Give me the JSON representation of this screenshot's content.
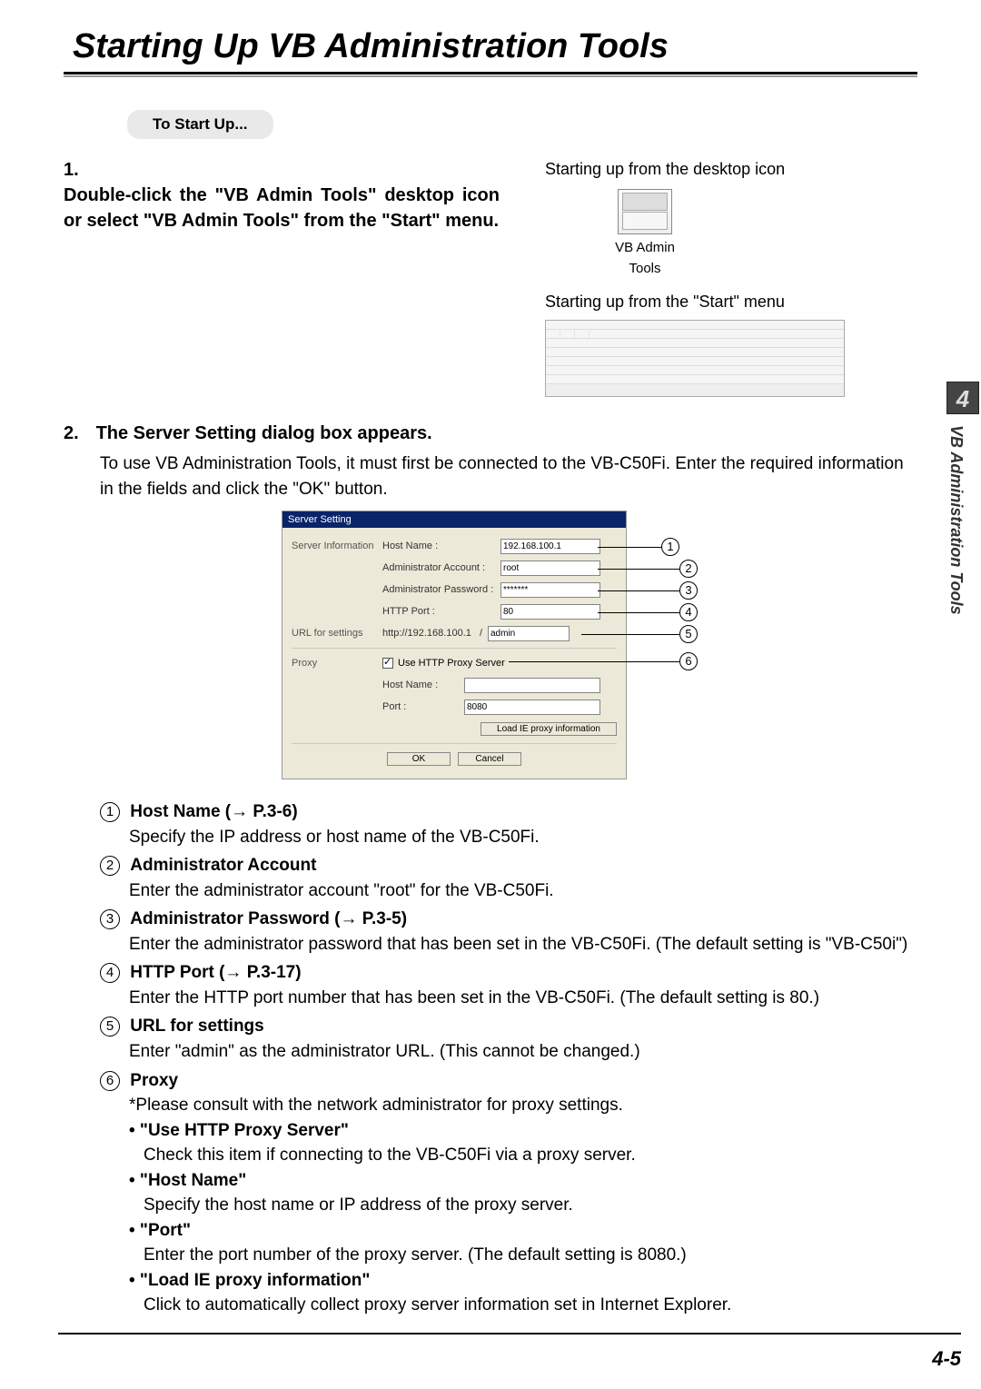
{
  "title": "Starting Up VB Administration Tools",
  "chapter_badge": "4",
  "side_tab": "VB Administration Tools",
  "page_number": "4-5",
  "startup_pill": "To Start Up...",
  "step1": {
    "number": "1.",
    "heading": "Double-click the \"VB Admin Tools\" desktop icon or select \"VB Admin Tools\" from the \"Start\" menu.",
    "right_caption_1": "Starting up from the desktop icon",
    "icon_label": "VB Admin\nTools",
    "right_caption_2": "Starting up from the \"Start\" menu"
  },
  "step2": {
    "number": "2.",
    "heading": "The Server Setting dialog box appears.",
    "body": "To use VB Administration Tools, it must first be connected to the VB-C50Fi. Enter the required information in the fields and click the \"OK\" button."
  },
  "dialog": {
    "title": "Server Setting",
    "section_server_info": "Server Information",
    "section_url": "URL for settings",
    "section_proxy": "Proxy",
    "host_name_label": "Host Name :",
    "host_name_value": "192.168.100.1",
    "admin_account_label": "Administrator Account :",
    "admin_account_value": "root",
    "admin_password_label": "Administrator Password :",
    "admin_password_value": "*******",
    "http_port_label": "HTTP Port :",
    "http_port_value": "80",
    "url_prefix": "http://192.168.100.1",
    "url_slash": "/",
    "url_value": "admin",
    "use_proxy_label": "Use HTTP Proxy Server",
    "proxy_host_label": "Host Name :",
    "proxy_host_value": "",
    "proxy_port_label": "Port :",
    "proxy_port_value": "8080",
    "load_ie_btn": "Load IE proxy information",
    "ok_btn": "OK",
    "cancel_btn": "Cancel"
  },
  "callouts": {
    "c1": "1",
    "c2": "2",
    "c3": "3",
    "c4": "4",
    "c5": "5",
    "c6": "6"
  },
  "definitions": [
    {
      "num": "1",
      "title": "Host Name (→ P.3-6)",
      "body": "Specify the IP address or host name of the VB-C50Fi."
    },
    {
      "num": "2",
      "title": "Administrator Account",
      "body": "Enter the administrator account \"root\" for the VB-C50Fi."
    },
    {
      "num": "3",
      "title": "Administrator Password (→ P.3-5)",
      "body": "Enter the administrator password that has been set in the VB-C50Fi. (The default setting is \"VB-C50i\")"
    },
    {
      "num": "4",
      "title": "HTTP Port (→ P.3-17)",
      "body": "Enter the HTTP port number that has been set in the VB-C50Fi. (The default setting is 80.)"
    },
    {
      "num": "5",
      "title": "URL for settings",
      "body": "Enter \"admin\" as the administrator URL. (This cannot be changed.)"
    },
    {
      "num": "6",
      "title": "Proxy",
      "body": "*Please consult with the network administrator for proxy settings.",
      "subs": [
        {
          "title": "• \"Use HTTP Proxy Server\"",
          "body": "Check this item if connecting to the VB-C50Fi via a proxy server."
        },
        {
          "title": "• \"Host Name\"",
          "body": "Specify the host name or IP address of the proxy server."
        },
        {
          "title": "• \"Port\"",
          "body": "Enter the port number of the proxy server. (The default setting is 8080.)"
        },
        {
          "title": "• \"Load IE proxy information\"",
          "body": "Click to automatically collect proxy server information set in Internet Explorer."
        }
      ]
    }
  ]
}
